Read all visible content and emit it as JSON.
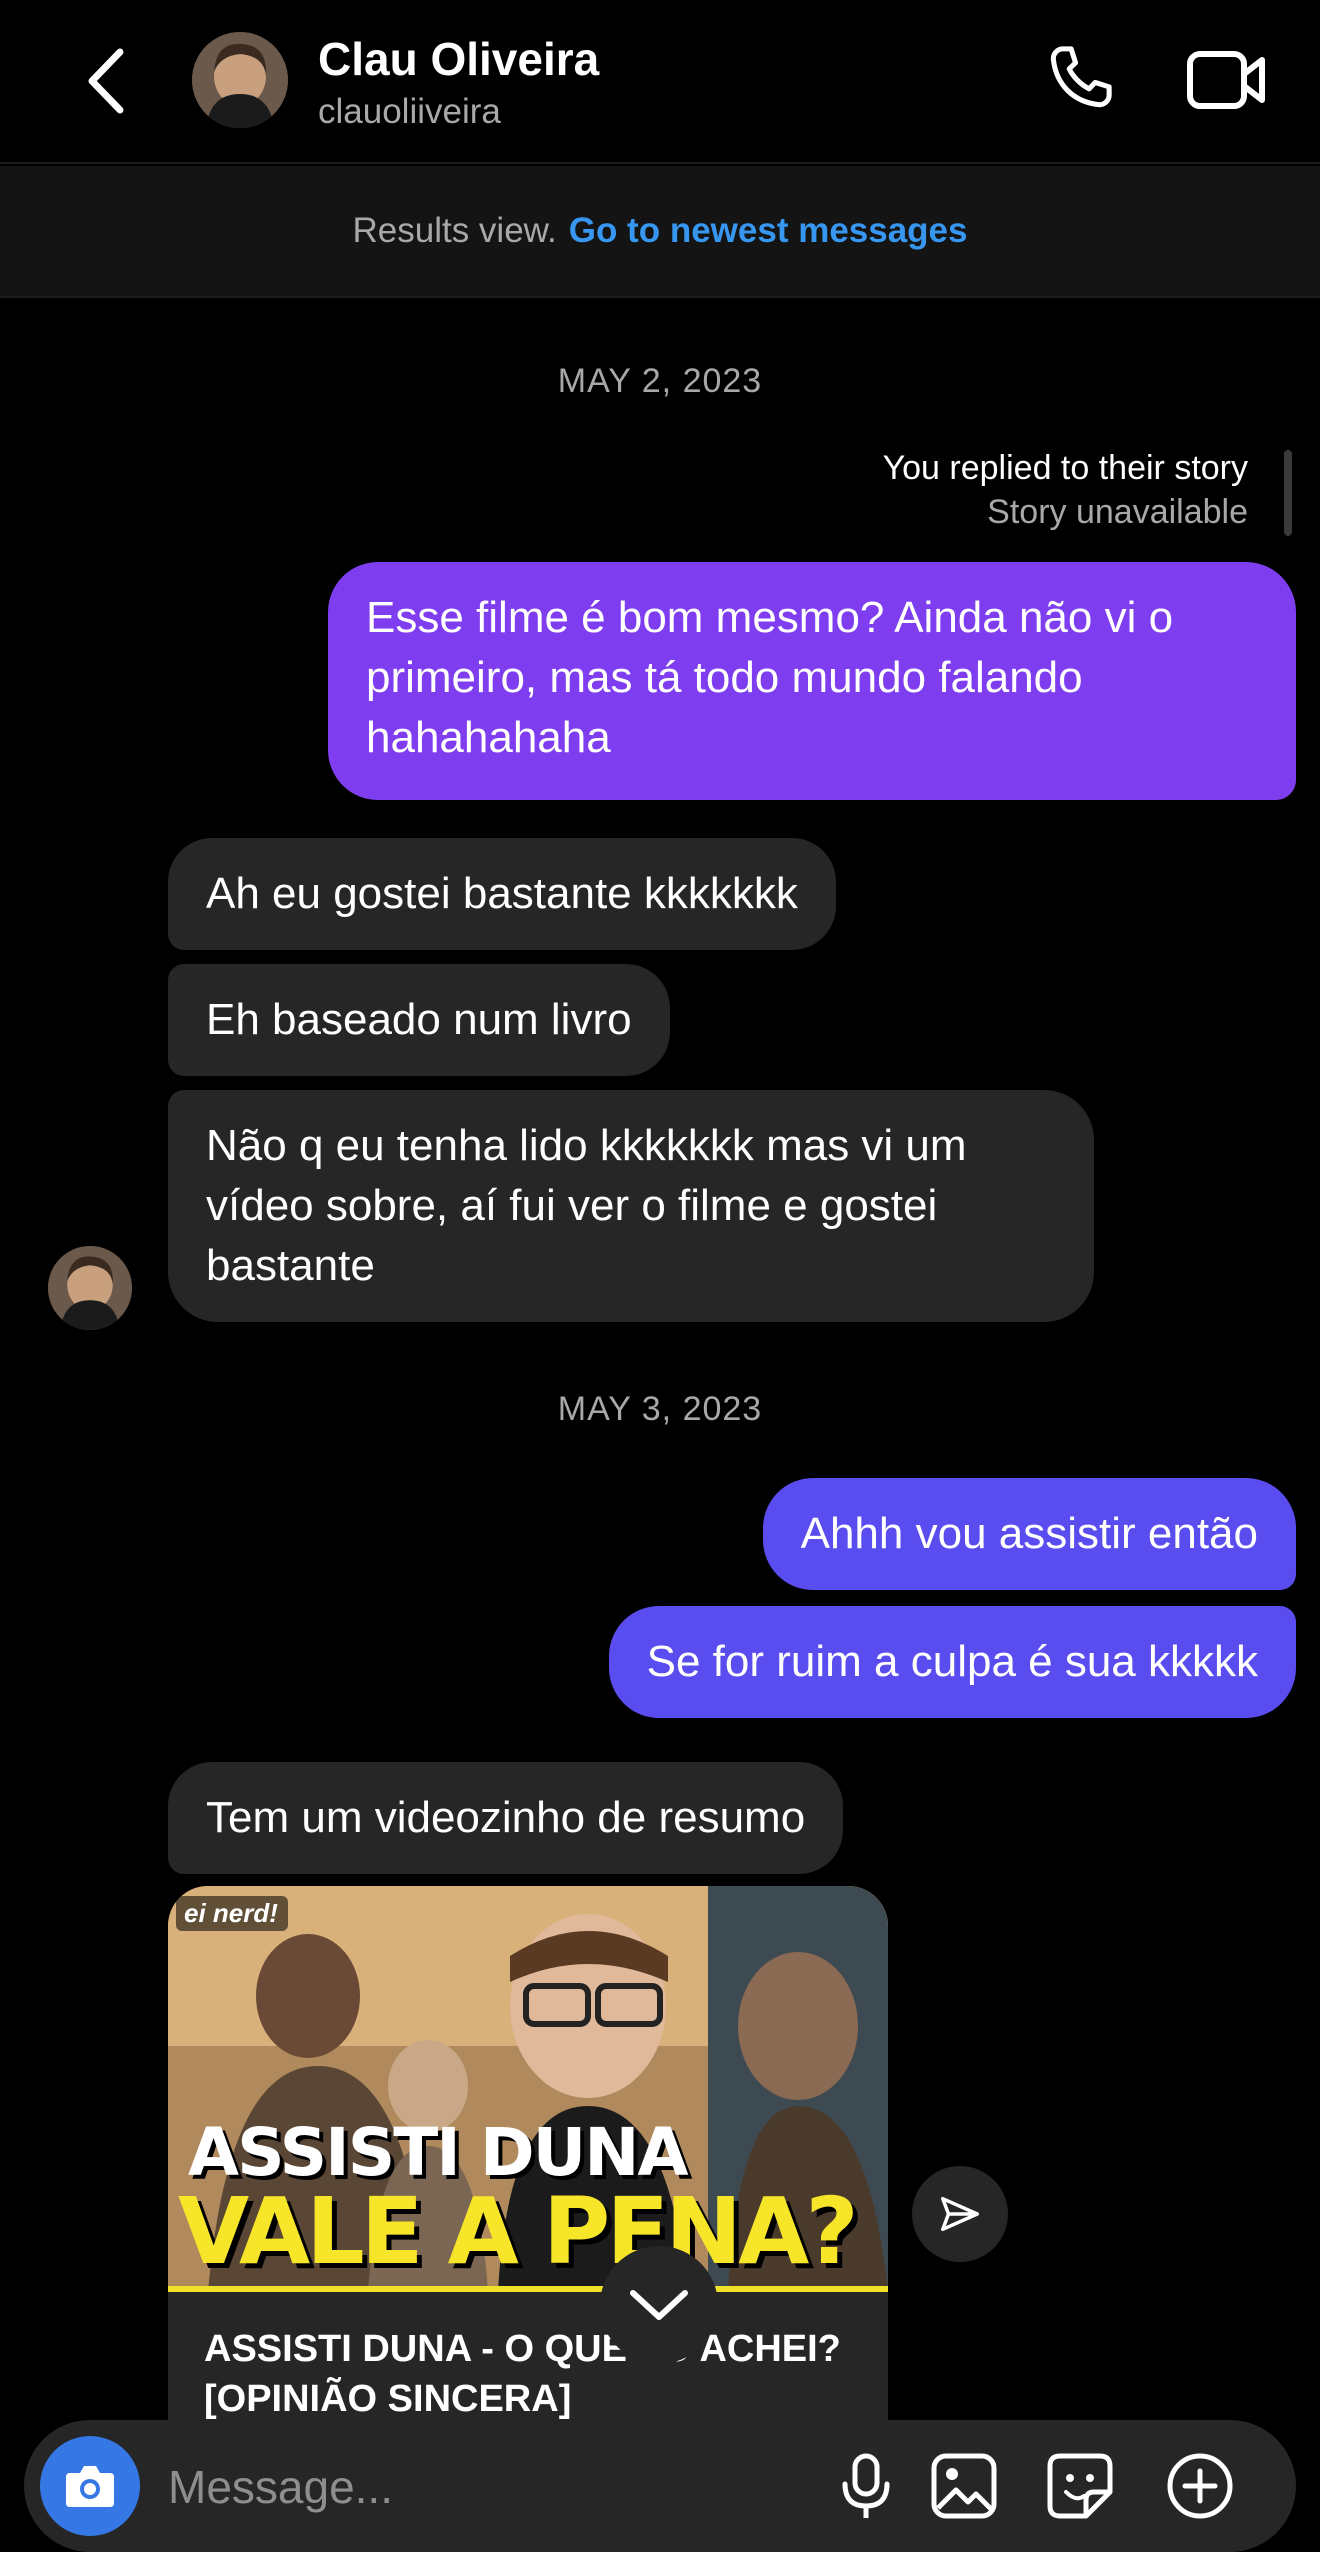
{
  "header": {
    "name": "Clau Oliveira",
    "username": "clauoliiveira"
  },
  "results_bar": {
    "text": "Results view.",
    "link": "Go to newest messages"
  },
  "dates": [
    "MAY 2, 2023",
    "MAY 3, 2023"
  ],
  "story_note": {
    "line1": "You replied to their story",
    "line2": "Story unavailable"
  },
  "messages": [
    {
      "from": "me",
      "text": "Esse filme é bom mesmo? Ainda não vi o primeiro, mas tá todo mundo falando hahahahaha"
    },
    {
      "from": "them",
      "text": "Ah eu gostei bastante kkkkkkk"
    },
    {
      "from": "them",
      "text": "Eh baseado num livro"
    },
    {
      "from": "them",
      "text": "Não q eu tenha lido kkkkkkk mas vi um vídeo sobre, aí fui ver o filme e gostei bastante"
    },
    {
      "from": "me",
      "text": "Ahhh vou assistir então"
    },
    {
      "from": "me",
      "text": "Se for ruim a culpa é sua kkkkk"
    },
    {
      "from": "them",
      "text": "Tem um videozinho de resumo"
    }
  ],
  "shared_video": {
    "channel_logo": "ei nerd!",
    "thumb_line1": "ASSISTI DUNA",
    "thumb_line2": "VALE A PENA?",
    "title": "ASSISTI DUNA - O QUE EU ACHEI? [OPINIÃO SINCERA]"
  },
  "composer": {
    "placeholder": "Message..."
  },
  "colors": {
    "bubble_purple": "#7f3df0",
    "bubble_indigo": "#5a4df0",
    "bubble_incoming": "#262626",
    "link_blue": "#3797f0",
    "camera_blue": "#3578e5"
  },
  "icons": [
    "back-icon",
    "phone-icon",
    "video-call-icon",
    "send-icon",
    "chevron-down-icon",
    "camera-icon",
    "microphone-icon",
    "gallery-icon",
    "sticker-icon",
    "plus-icon"
  ]
}
